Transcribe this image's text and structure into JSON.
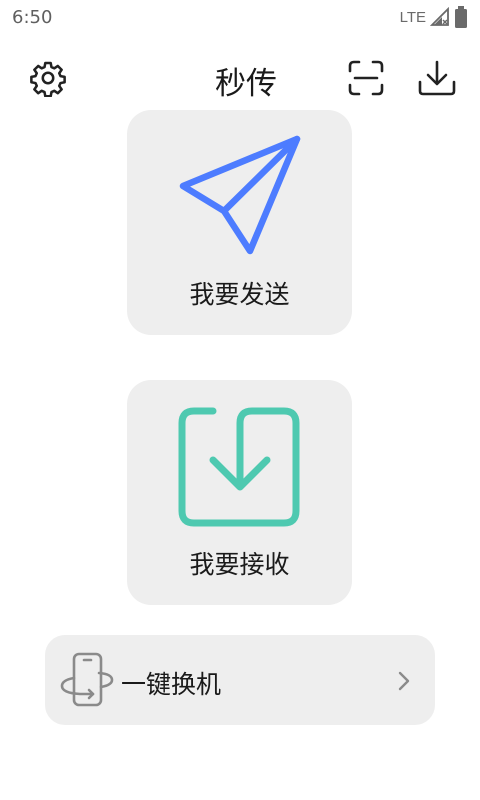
{
  "status_bar": {
    "time": "6:50",
    "network": "LTE",
    "icons": [
      "signal-icon",
      "battery-icon"
    ]
  },
  "header": {
    "title": "秒传",
    "icons": [
      "settings-icon",
      "scan-icon",
      "download-icon"
    ]
  },
  "send_card": {
    "label": "我要发送",
    "icon": "paper-plane-icon",
    "icon_color": "#4d7cff"
  },
  "receive_card": {
    "label": "我要接收",
    "icon": "receive-arrow-icon",
    "icon_color": "#4ec9b0"
  },
  "switch_phone": {
    "label": "一键换机",
    "icon": "phone-switch-icon",
    "trailing_icon": "chevron-right-icon"
  },
  "colors": {
    "card_background": "#eeeeee",
    "page_background": "#ffffff"
  }
}
